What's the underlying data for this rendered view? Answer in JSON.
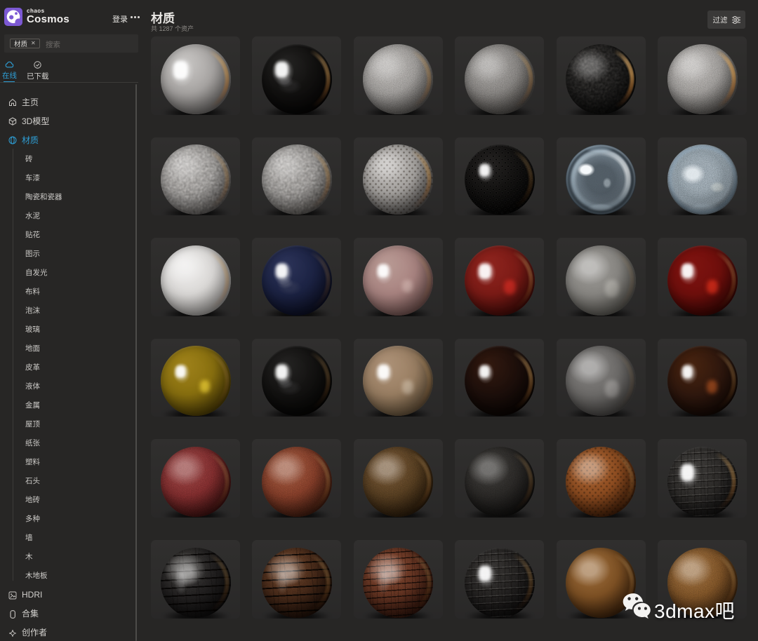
{
  "app": {
    "brand_small": "chaos",
    "brand_large": "Cosmos",
    "login_label": "登录",
    "accent_blue": "#2e9fd6",
    "brand_purple": "#7c59d3"
  },
  "search": {
    "tag": "材质",
    "placeholder": "搜索",
    "remove_icon_glyph": "✕"
  },
  "tabs": [
    {
      "label": "在线",
      "icon": "cloud-icon",
      "active": true
    },
    {
      "label": "已下载",
      "icon": "check-circle-icon",
      "active": false
    }
  ],
  "nav": {
    "items": [
      {
        "label": "主页",
        "icon": "home",
        "active": false
      },
      {
        "label": "3D模型",
        "icon": "cube",
        "active": false
      },
      {
        "label": "材质",
        "icon": "sphere",
        "active": true
      }
    ],
    "subitems": [
      "砖",
      "车漆",
      "陶瓷和瓷器",
      "水泥",
      "贴花",
      "图示",
      "自发光",
      "布料",
      "泡沫",
      "玻璃",
      "地面",
      "皮革",
      "液体",
      "金属",
      "屋顶",
      "纸张",
      "塑料",
      "石头",
      "地砖",
      "多种",
      "墙",
      "木",
      "木地板"
    ],
    "bottom": [
      {
        "label": "HDRI",
        "icon": "image",
        "active": false
      },
      {
        "label": "合集",
        "icon": "collection",
        "active": false
      },
      {
        "label": "创作者",
        "icon": "sparkle",
        "active": false
      }
    ]
  },
  "header": {
    "title": "材质",
    "count": "共 1287 个资产",
    "filter_label": "过滤"
  },
  "watermark": {
    "text": "3dmax吧",
    "icon": "wechat-icon"
  },
  "grid": {
    "columns": 6,
    "spheres": [
      {
        "name": "porcelain-gray-glossy",
        "light": "#c9c7c5",
        "base": "#a8a5a3",
        "dark": "#6b6866",
        "gloss": 1,
        "rim": 0.6,
        "tex": "none"
      },
      {
        "name": "black-glossy",
        "light": "#242322",
        "base": "#121110",
        "dark": "#050404",
        "gloss": 1,
        "rim": 0.5,
        "hs": 0.9,
        "tex": "none",
        "bounce": true
      },
      {
        "name": "plaster-light",
        "light": "#c2bfbc",
        "base": "#a7a4a1",
        "dark": "#565350",
        "gloss": 0.18,
        "rim": 0.35,
        "tex": "fine"
      },
      {
        "name": "concrete-gray",
        "light": "#b0adaa",
        "base": "#8c8986",
        "dark": "#484542",
        "gloss": 0.2,
        "rim": 0.35,
        "tex": "fine"
      },
      {
        "name": "asphalt-black",
        "light": "#3a3836",
        "base": "#222120",
        "dark": "#080807",
        "gloss": 0.3,
        "rim": 0.75,
        "tex": "coarse-dark"
      },
      {
        "name": "plaster-rim",
        "light": "#c6c3c0",
        "base": "#a7a4a1",
        "dark": "#504d4a",
        "gloss": 0.25,
        "rim": 0.75,
        "tex": "fine"
      },
      {
        "name": "stucco-gray",
        "light": "#c6c3c0",
        "base": "#a6a3a0",
        "dark": "#555250",
        "gloss": 0.15,
        "rim": 0.3,
        "tex": "coarse"
      },
      {
        "name": "stucco-heavy",
        "light": "#c2bfbc",
        "base": "#a29f9c",
        "dark": "#514e4b",
        "gloss": 0.15,
        "rim": 0.35,
        "tex": "coarse"
      },
      {
        "name": "dimpled-gray",
        "light": "#c2bfbc",
        "base": "#a4a19e",
        "dark": "#4e4b49",
        "gloss": 0.3,
        "rim": 0.5,
        "tex": "dots"
      },
      {
        "name": "perforated-black",
        "light": "#242221",
        "base": "#121110",
        "dark": "#030303",
        "gloss": 0.9,
        "rim": 0.25,
        "hs": 0.7,
        "tex": "dots-lit"
      },
      {
        "name": "glass-clear",
        "type": "glass-clear",
        "light": "#dce8f0",
        "base": "#6d7880",
        "dark": "#45505a",
        "gloss": 1,
        "rim": 0,
        "tex": "none"
      },
      {
        "name": "glass-frosted",
        "type": "glass-frost",
        "light": "#c4d2da",
        "base": "#93a2ac",
        "dark": "#5d6a73",
        "gloss": 0.4,
        "rim": 0,
        "tex": "fine"
      },
      {
        "name": "white-matte",
        "light": "#eeedec",
        "base": "#dcdad8",
        "dark": "#a3a09d",
        "gloss": 0.3,
        "rim": 0.3,
        "tex": "none"
      },
      {
        "name": "navy-glossy",
        "light": "#2c3358",
        "base": "#1c2344",
        "dark": "#0b0e22",
        "gloss": 1,
        "rim": 0.2,
        "hs": 0.8,
        "tex": "none",
        "bounce": true
      },
      {
        "name": "rose-glass",
        "light": "#b89a94",
        "base": "#a98481",
        "dark": "#73524f",
        "gloss": 0.8,
        "rim": 0.15,
        "hs": 0.75,
        "tex": "none",
        "inner": "rgba(222,196,190,.5)"
      },
      {
        "name": "red-glossy",
        "light": "#8e241e",
        "base": "#7c1b16",
        "dark": "#420b08",
        "gloss": 1,
        "rim": 0.35,
        "hs": 0.85,
        "tex": "none",
        "inner": "rgba(205,42,34,.8)"
      },
      {
        "name": "smoke-glass",
        "light": "#9c9a96",
        "base": "#898783",
        "dark": "#57554f",
        "gloss": 0.5,
        "rim": 0.1,
        "tex": "none",
        "inner": "rgba(212,209,202,.4)"
      },
      {
        "name": "dark-red-glossy",
        "light": "#7e1310",
        "base": "#700f0c",
        "dark": "#380604",
        "gloss": 1,
        "rim": 0.3,
        "hs": 0.8,
        "tex": "none",
        "inner": "rgba(208,44,26,.85)"
      },
      {
        "name": "amber-glass",
        "light": "#9e811a",
        "base": "#89700f",
        "dark": "#4a3a06",
        "gloss": 1,
        "rim": 0.2,
        "hs": 0.7,
        "tex": "none",
        "inner": "rgba(226,198,50,.8)"
      },
      {
        "name": "black-glossy-2",
        "light": "#242322",
        "base": "#131211",
        "dark": "#040403",
        "gloss": 1,
        "rim": 0.25,
        "hs": 0.8,
        "tex": "none",
        "bounce": true
      },
      {
        "name": "tan-glass",
        "light": "#ac9177",
        "base": "#9a7f63",
        "dark": "#655239",
        "gloss": 0.85,
        "rim": 0.2,
        "hs": 0.8,
        "tex": "none",
        "inner": "rgba(215,200,180,.55)"
      },
      {
        "name": "espresso-glossy",
        "light": "#32190f",
        "base": "#1d0f0b",
        "dark": "#080402",
        "gloss": 0.9,
        "rim": 0.45,
        "hs": 0.7,
        "tex": "none"
      },
      {
        "name": "smoke-transparent",
        "light": "#848280",
        "base": "#6e6c6a",
        "dark": "#454341",
        "gloss": 0.5,
        "rim": 0.1,
        "tex": "none",
        "inner": "rgba(198,196,192,.4)"
      },
      {
        "name": "chocolate-glossy",
        "light": "#47230f",
        "base": "#30180e",
        "dark": "#100704",
        "gloss": 1,
        "rim": 0.3,
        "hs": 0.75,
        "tex": "none",
        "inner": "rgba(158,74,30,.8)"
      },
      {
        "name": "red-leather",
        "light": "#9e4a48",
        "base": "#842e2f",
        "dark": "#380e0d",
        "gloss": 0.3,
        "rim": 0.25,
        "tex": "fine"
      },
      {
        "name": "terracotta",
        "light": "#a65e44",
        "base": "#883f2a",
        "dark": "#3b190d",
        "gloss": 0.35,
        "rim": 0.3,
        "tex": "fine"
      },
      {
        "name": "brown-leather",
        "light": "#7a5b3a",
        "base": "#594022",
        "dark": "#271808",
        "gloss": 0.45,
        "rim": 0.3,
        "tex": "fine"
      },
      {
        "name": "black-rubber",
        "light": "#413f3c",
        "base": "#2b2927",
        "dark": "#0d0c0b",
        "gloss": 0.3,
        "rim": 0.25,
        "tex": "fine"
      },
      {
        "name": "perforated-tan-leather",
        "light": "#aa6636",
        "base": "#8d4c20",
        "dark": "#3d1b07",
        "gloss": 0.5,
        "rim": 0.3,
        "tex": "dots"
      },
      {
        "name": "gray-croc",
        "light": "#3f3d3b",
        "base": "#2e2c2a",
        "dark": "#0f0e0e",
        "gloss": 0.8,
        "rim": 0.45,
        "hs": 0.9,
        "tex": "croc-light"
      },
      {
        "name": "charred-bricks",
        "light": "#44423f",
        "base": "#222020",
        "dark": "#0a0909",
        "gloss": 0.5,
        "rim": 0.25,
        "tex": "bricks",
        "sheen": 0.24
      },
      {
        "name": "burnt-bricks-brown",
        "light": "#74492e",
        "base": "#482a19",
        "dark": "#190c06",
        "gloss": 0.4,
        "rim": 0.3,
        "tex": "bricks",
        "sheen": 0.2
      },
      {
        "name": "croc-redbrown",
        "light": "#8a4c34",
        "base": "#633321",
        "dark": "#2a1009",
        "gloss": 0.45,
        "rim": 0.25,
        "tex": "croc",
        "sheen": 0.22
      },
      {
        "name": "croc-black",
        "light": "#3a3836",
        "base": "#242221",
        "dark": "#0a0909",
        "gloss": 0.75,
        "rim": 0.3,
        "hs": 0.85,
        "tex": "croc-light"
      },
      {
        "name": "caramel-leather-smooth",
        "light": "#9e6f3e",
        "base": "#7e5124",
        "dark": "#361d09",
        "gloss": 0.5,
        "rim": 0.3,
        "tex": "none"
      },
      {
        "name": "caramel-leather",
        "light": "#a37344",
        "base": "#815528",
        "dark": "#39200b",
        "gloss": 0.45,
        "rim": 0.3,
        "tex": "fine"
      }
    ]
  }
}
